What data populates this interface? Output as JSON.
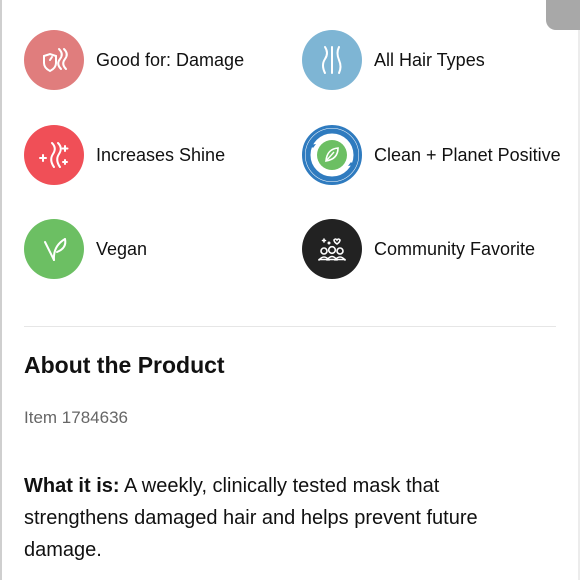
{
  "badges": [
    {
      "label": "Good for: Damage",
      "icon": "damage-hair-icon",
      "color": "#e07d7d"
    },
    {
      "label": "All Hair Types",
      "icon": "hair-strands-icon",
      "color": "#7eb5d4"
    },
    {
      "label": "Increases Shine",
      "icon": "shine-icon",
      "color": "#f04f57"
    },
    {
      "label": "Clean + Planet Positive",
      "icon": "clean-planet-positive-icon",
      "color": "#2f7bbf",
      "seal_text": "CLEAN + PLANET POSITIVE · SEPHORA"
    },
    {
      "label": "Vegan",
      "icon": "vegan-leaf-icon",
      "color": "#6cbf63"
    },
    {
      "label": "Community Favorite",
      "icon": "community-favorite-icon",
      "color": "#222222"
    }
  ],
  "about": {
    "title": "About the Product",
    "item_prefix": "Item",
    "item_number": "1784636",
    "what_it_is_label": "What it is:",
    "what_it_is_text": " A weekly, clinically tested mask that strengthens damaged hair and helps prevent future damage."
  }
}
